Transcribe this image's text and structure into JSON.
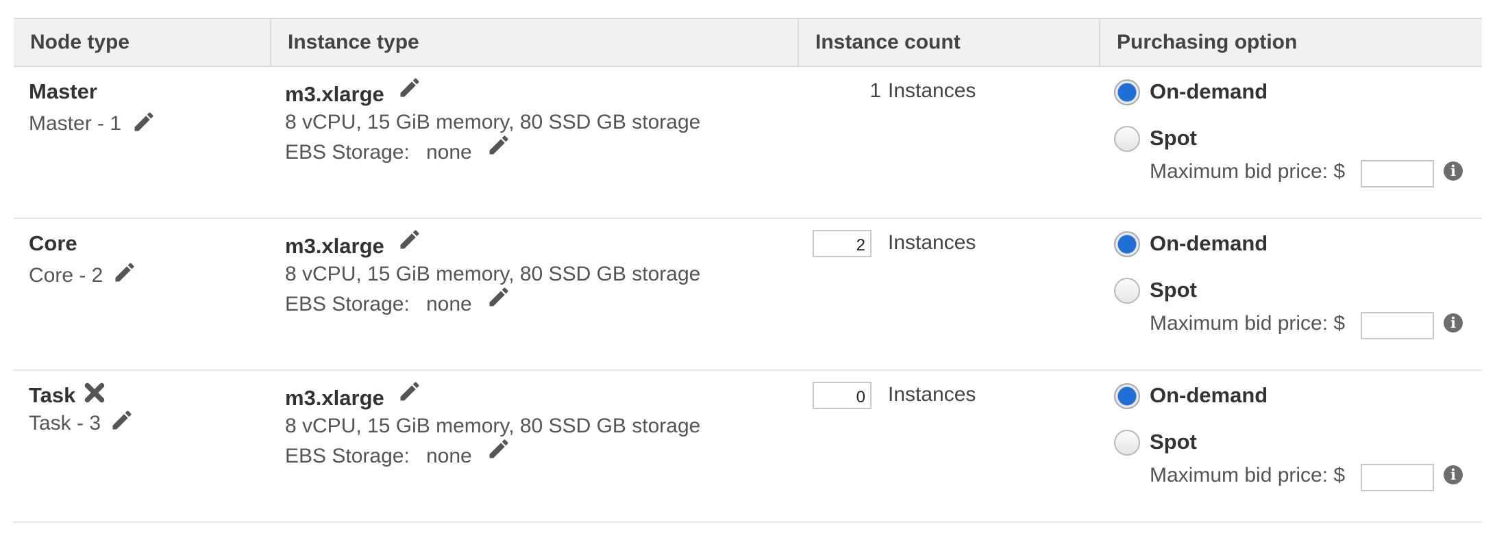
{
  "table": {
    "headers": {
      "node_type": "Node type",
      "instance_type": "Instance type",
      "instance_count": "Instance count",
      "purchasing_option": "Purchasing option"
    },
    "rows": [
      {
        "node_type": "Master",
        "node_name": "Master - 1",
        "instance_type": "m3.xlarge",
        "specs": "8 vCPU, 15 GiB memory, 80 SSD GB storage",
        "ebs_label": "EBS Storage:",
        "ebs_value": "none",
        "count": "1",
        "count_unit": "Instances",
        "on_demand": "On-demand",
        "spot": "Spot",
        "bid_label": "Maximum bid price: $",
        "bid_value": "",
        "selected": "on-demand"
      },
      {
        "node_type": "Core",
        "node_name": "Core - 2",
        "instance_type": "m3.xlarge",
        "specs": "8 vCPU, 15 GiB memory, 80 SSD GB storage",
        "ebs_label": "EBS Storage:",
        "ebs_value": "none",
        "count": "2",
        "count_unit": "Instances",
        "on_demand": "On-demand",
        "spot": "Spot",
        "bid_label": "Maximum bid price: $",
        "bid_value": "",
        "selected": "on-demand"
      },
      {
        "node_type": "Task",
        "node_name": "Task - 3",
        "instance_type": "m3.xlarge",
        "specs": "8 vCPU, 15 GiB memory, 80 SSD GB storage",
        "ebs_label": "EBS Storage:",
        "ebs_value": "none",
        "count": "0",
        "count_unit": "Instances",
        "on_demand": "On-demand",
        "spot": "Spot",
        "bid_label": "Maximum bid price: $",
        "bid_value": "",
        "selected": "on-demand"
      }
    ]
  },
  "icons": {
    "edit": "pencil-icon",
    "remove": "close-icon",
    "info": "info-icon"
  },
  "colors": {
    "radio_selected": "#1f6fd6",
    "header_bg": "#f1f1f1"
  }
}
